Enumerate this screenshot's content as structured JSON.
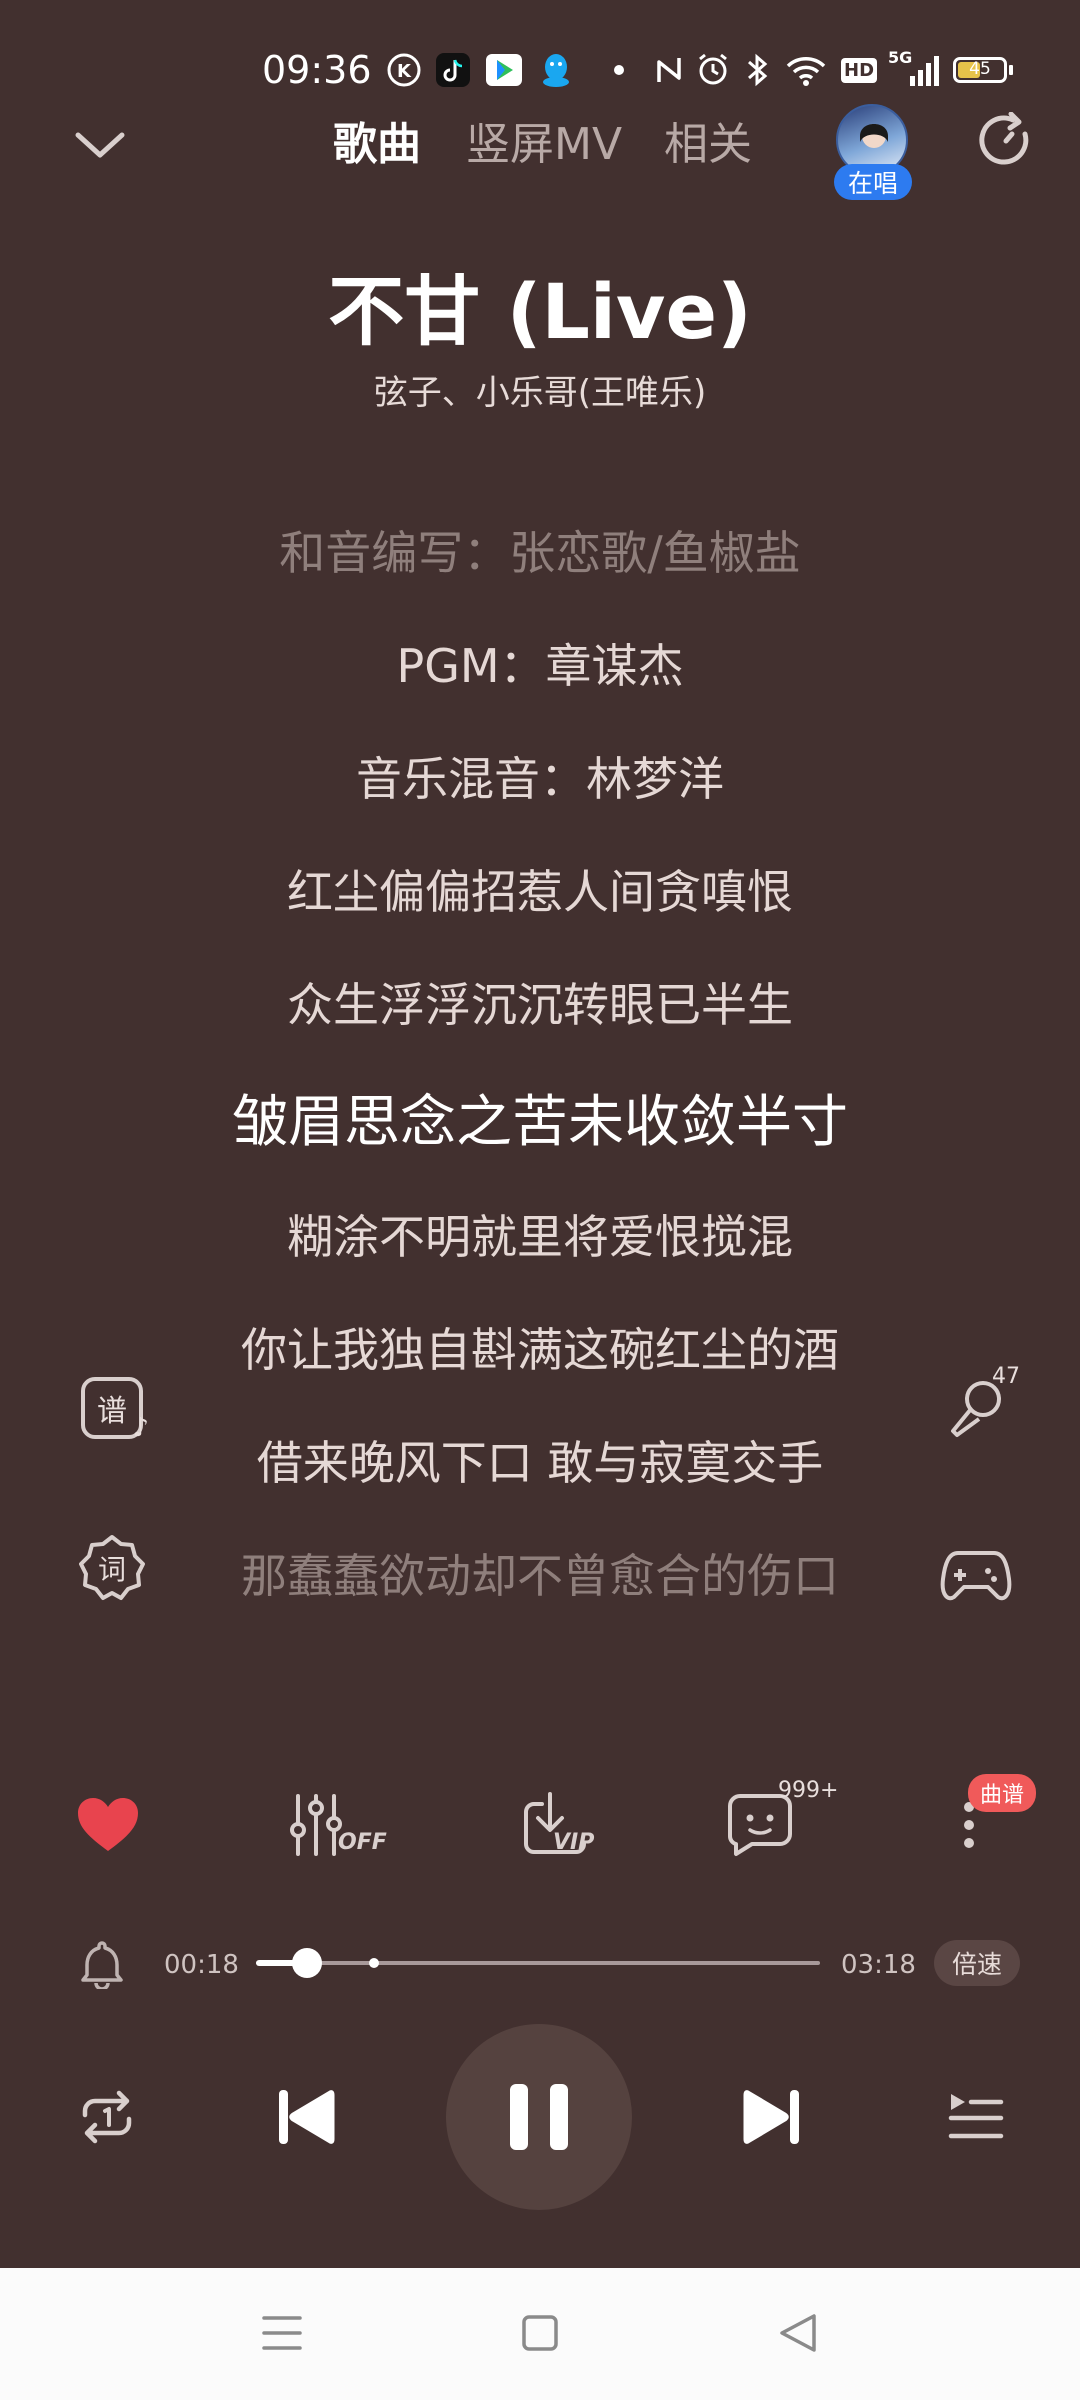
{
  "status": {
    "time": "09:36",
    "battery": "45",
    "network": "5G",
    "hd": "HD",
    "icons": [
      "kuwo-icon",
      "tiktok-icon",
      "video-app-icon",
      "qq-icon",
      "dot-icon",
      "nfc-icon",
      "alarm-icon",
      "bluetooth-icon",
      "wifi-icon",
      "hd-icon",
      "signal-icon",
      "battery-icon"
    ]
  },
  "header": {
    "tabs": [
      {
        "label": "歌曲",
        "active": true
      },
      {
        "label": "竖屏MV",
        "active": false
      },
      {
        "label": "相关",
        "active": false
      }
    ],
    "singing_badge": "在唱"
  },
  "song": {
    "title": "不甘 (Live)",
    "artist": "弦子、小乐哥(王唯乐)"
  },
  "lyrics": [
    {
      "text": "和音编写：张恋歌/鱼椒盐",
      "state": "dim"
    },
    {
      "text": "PGM：章谋杰",
      "state": "normal"
    },
    {
      "text": "音乐混音：林梦洋",
      "state": "normal"
    },
    {
      "text": "红尘偏偏招惹人间贪嗔恨",
      "state": "normal"
    },
    {
      "text": "众生浮浮沉沉转眼已半生",
      "state": "normal"
    },
    {
      "text": "皱眉思念之苦未收敛半寸",
      "state": "current"
    },
    {
      "text": "糊涂不明就里将爱恨搅混",
      "state": "normal"
    },
    {
      "text": "你让我独自斟满这碗红尘的酒",
      "state": "normal"
    },
    {
      "text": "借来晚风下口 敢与寂寞交手",
      "state": "normal"
    },
    {
      "text": "那蠢蠢欲动却不曾愈合的伤口",
      "state": "dim"
    }
  ],
  "side": {
    "score_label": "谱",
    "lyric_label": "词",
    "mic_count": "47"
  },
  "actions": {
    "effect_label": "OFF",
    "download_label": "VIP",
    "comment_count": "999+",
    "more_badge": "曲谱"
  },
  "progress": {
    "current": "00:18",
    "total": "03:18",
    "speed_label": "倍速",
    "fraction": 0.09
  },
  "colors": {
    "background": "#42302f",
    "heart": "#e8444e",
    "badge_blue": "#2d7bf0",
    "badge_red": "#f05a5a"
  }
}
